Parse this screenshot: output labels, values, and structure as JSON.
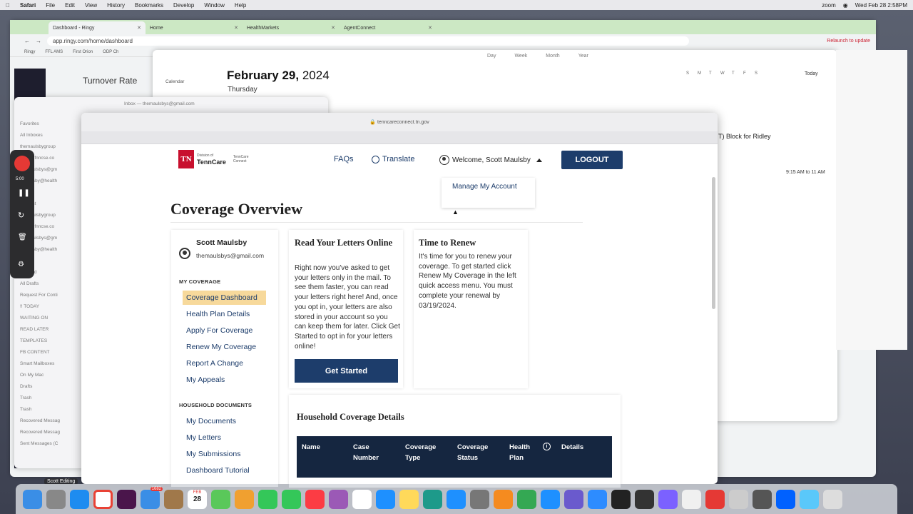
{
  "menubar": {
    "app": "Safari",
    "items": [
      "File",
      "Edit",
      "View",
      "History",
      "Bookmarks",
      "Develop",
      "Window",
      "Help"
    ],
    "zoom": "zoom",
    "clock": "Wed Feb 28  2:58PM"
  },
  "chrome": {
    "tabs": [
      {
        "label": "Dashboard - Ringy"
      },
      {
        "label": "Home"
      },
      {
        "label": "HealthMarkets"
      },
      {
        "label": "AgentConnect"
      }
    ],
    "url": "app.ringy.com/home/dashboard",
    "relaunch": "Relaunch to update",
    "bookmarks": [
      "Ringy",
      "FFL AMS",
      "First Orion",
      "ODP Ch"
    ],
    "turnover": "Turnover Rate"
  },
  "calendar": {
    "date_month": "February 29,",
    "date_year": " 2024",
    "weekday": "Thursday",
    "view_tabs": [
      "Day",
      "Week",
      "Month",
      "Year"
    ],
    "today": "Today",
    "event_title": "T) Block for Ridley",
    "event_time": "9:15 AM to 11 AM",
    "calendar_item": "Calendar",
    "mini_days": [
      "S",
      "M",
      "T",
      "W",
      "T",
      "F",
      "S"
    ]
  },
  "mail": {
    "inbox": "Inbox — themaulsbys@gmail.com",
    "sidebar": [
      "Favorites",
      "All Inboxes",
      "themaulsbygroup",
      "scott@fnncse.co",
      "themaulsbys@gm",
      "amaulsby@health",
      "iCloud",
      "All Sent",
      "themaulsbygroup",
      "scott@fnncse.co",
      "themaulsbys@gm",
      "amaulsby@health",
      "iCloud",
      "Flagged",
      "All Drafts",
      "Request For Conti",
      "!! TODAY",
      "WAITING ON",
      "READ LATER",
      "TEMPLATES",
      "FB CONTENT",
      "Smart Mailboxes",
      "On My Mac",
      "Drafts",
      "Trash",
      "Trash",
      "Recovered Messag",
      "Recovered Messag",
      "Sent Messages (C"
    ]
  },
  "recording": {
    "time": "5:00"
  },
  "safari": {
    "url": "tenncareconnect.tn.gov"
  },
  "tenncare": {
    "logo_tn": "TN",
    "logo_div": "Division of",
    "logo_name": "TennCare",
    "logo_connect": "TennCare Connect",
    "nav": {
      "faqs": "FAQs",
      "translate": "Translate",
      "welcome": "Welcome, Scott Maulsby",
      "logout": "LOGOUT"
    },
    "dropdown": {
      "manage": "Manage My Account"
    },
    "page_title": "Coverage Overview",
    "user": {
      "name": "Scott Maulsby",
      "email": "themaulsbys@gmail.com"
    },
    "my_coverage_heading": "MY COVERAGE",
    "my_coverage_links": [
      "Coverage Dashboard",
      "Health Plan Details",
      "Apply For Coverage",
      "Renew My Coverage",
      "Report A Change",
      "My Appeals"
    ],
    "household_docs_heading": "HOUSEHOLD DOCUMENTS",
    "household_doc_links": [
      "My Documents",
      "My Letters",
      "My Submissions",
      "Dashboard Tutorial"
    ],
    "letters_card": {
      "title": "Read Your Letters Online",
      "body": "Right now you've asked to get your letters only in the mail. To see them faster, you can read your letters right here! And, once you opt in, your letters are also stored in your account so you can keep them for later. Click Get Started to opt in for your letters online!",
      "button": "Get Started"
    },
    "renew_card": {
      "title": "Time to Renew",
      "body": "It's time for you to renew your coverage. To get started click Renew My Coverage in the left quick access menu. You must complete your renewal by 03/19/2024."
    },
    "household": {
      "title": "Household Coverage Details",
      "columns": [
        "Name",
        "Case Number",
        "Coverage Type",
        "Coverage Status",
        "Health Plan",
        "Details"
      ]
    }
  },
  "dock": {
    "label": "Scott Editing",
    "badge_mail": "1682",
    "cal_day": "28",
    "cal_month": "FEB"
  },
  "colors": {
    "tn_red": "#c8102e",
    "tn_navy": "#1d3d6b",
    "active_nav": "#f7d99b",
    "table_header": "#152640"
  }
}
